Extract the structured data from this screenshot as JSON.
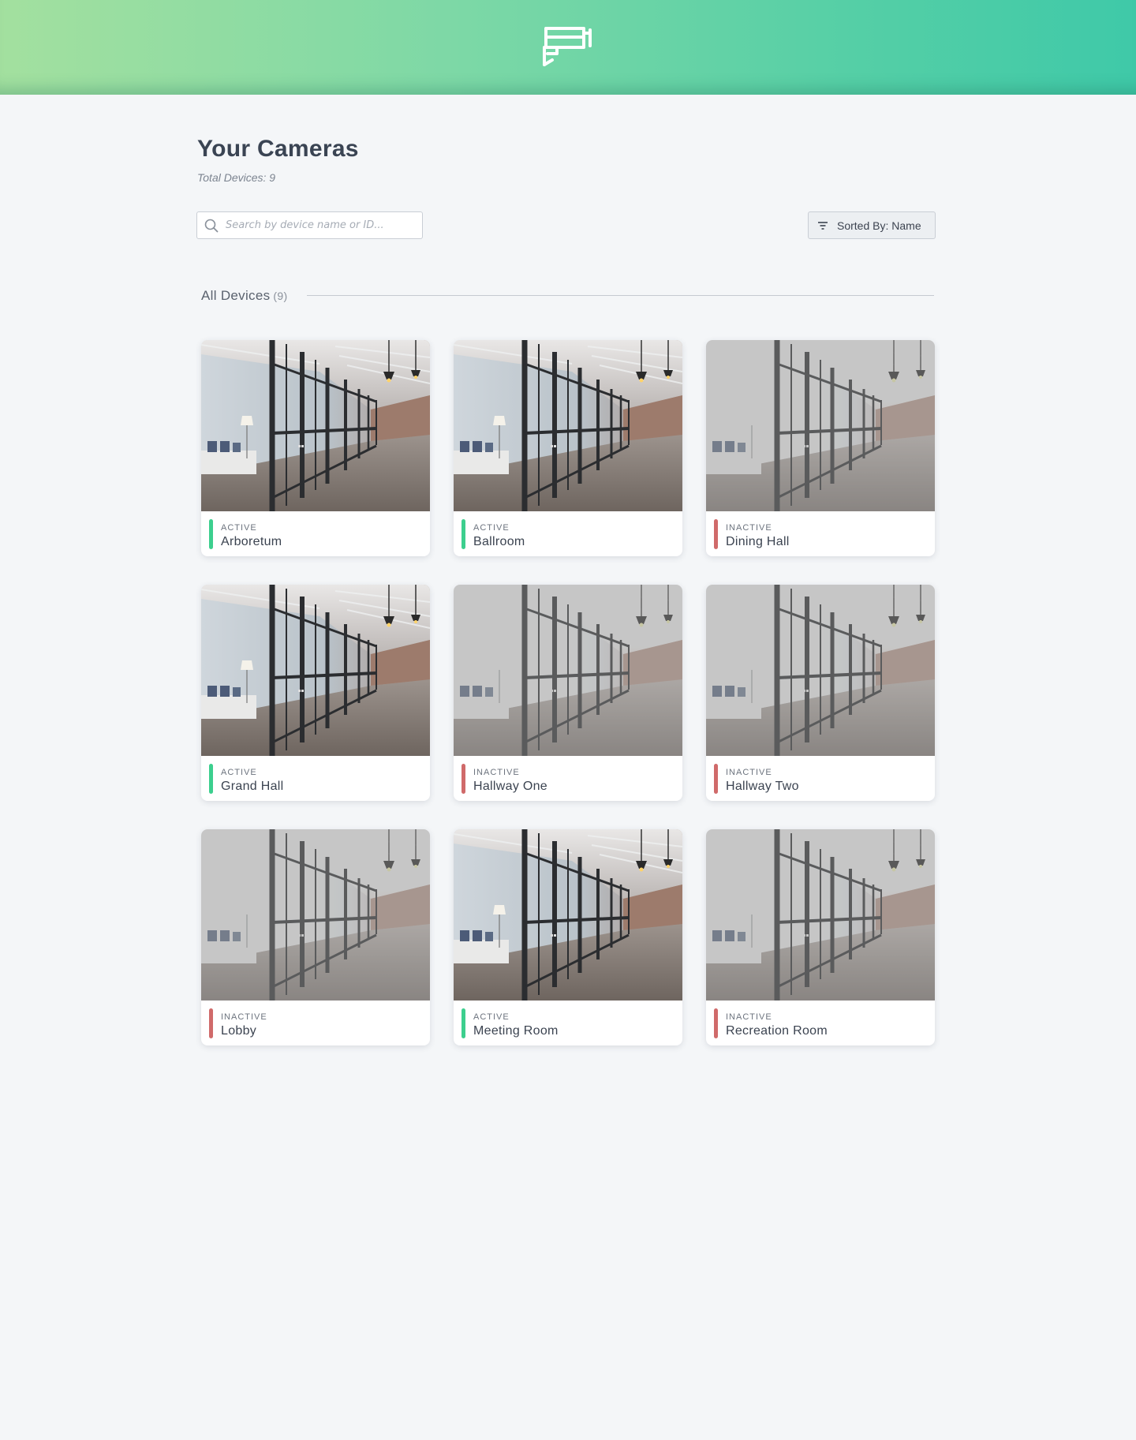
{
  "header": {
    "logo_icon": "security-camera-icon"
  },
  "page": {
    "title": "Your Cameras",
    "total": "Total Devices: 9"
  },
  "search": {
    "placeholder": "Search by device name or ID...",
    "icon": "search-icon"
  },
  "sort": {
    "label": "Sorted By: Name",
    "icon": "filter-icon"
  },
  "section": {
    "title": "All Devices",
    "count": "(9)"
  },
  "colors": {
    "active": "#3ccf8e",
    "inactive": "#d06a6a"
  },
  "devices": [
    {
      "status": "ACTIVE",
      "name": "Arboretum"
    },
    {
      "status": "ACTIVE",
      "name": "Ballroom"
    },
    {
      "status": "INACTIVE",
      "name": "Dining Hall"
    },
    {
      "status": "ACTIVE",
      "name": "Grand Hall"
    },
    {
      "status": "INACTIVE",
      "name": "Hallway One"
    },
    {
      "status": "INACTIVE",
      "name": "Hallway Two"
    },
    {
      "status": "INACTIVE",
      "name": "Lobby"
    },
    {
      "status": "ACTIVE",
      "name": "Meeting Room"
    },
    {
      "status": "INACTIVE",
      "name": "Recreation Room"
    }
  ]
}
